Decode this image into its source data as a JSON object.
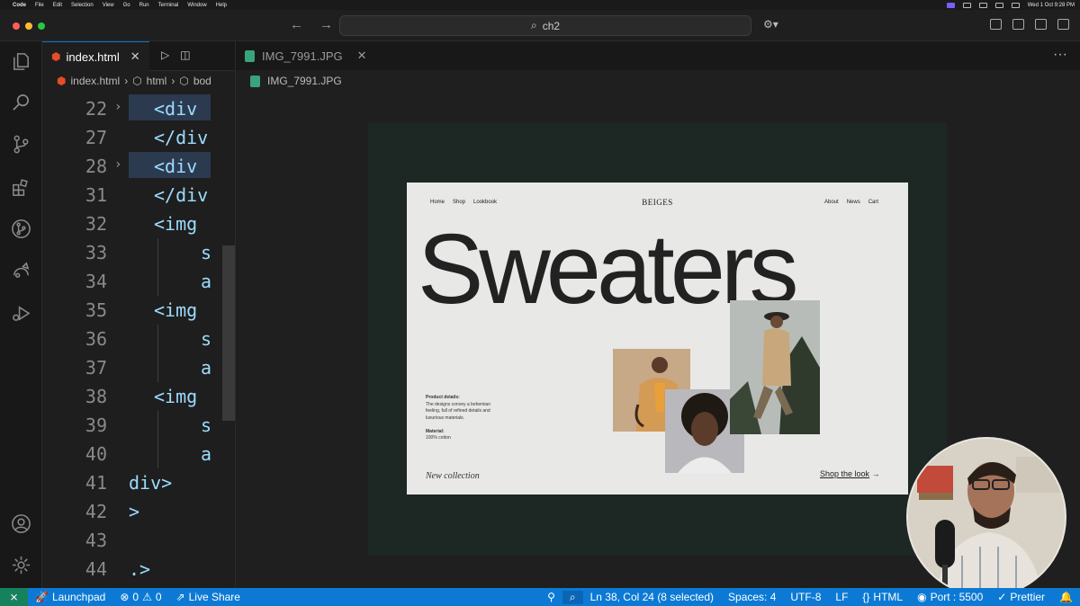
{
  "menubar": {
    "app": "Code",
    "items": [
      "File",
      "Edit",
      "Selection",
      "View",
      "Go",
      "Run",
      "Terminal",
      "Window",
      "Help"
    ],
    "clock": "Wed 1 Oct  9:28 PM"
  },
  "titlebar": {
    "search_text": "ch2"
  },
  "editor": {
    "tab_label": "index.html",
    "tab_close": "✕",
    "breadcrumb": [
      "index.html",
      "html",
      "bod"
    ],
    "lines": [
      {
        "num": "22",
        "fold": "›",
        "text": "<div",
        "indent": 1,
        "selected": true
      },
      {
        "num": "27",
        "fold": "",
        "text": "</div",
        "indent": 1,
        "selected": false
      },
      {
        "num": "28",
        "fold": "›",
        "text": "<div",
        "indent": 1,
        "selected": true
      },
      {
        "num": "31",
        "fold": "",
        "text": "</div",
        "indent": 1,
        "selected": false
      },
      {
        "num": "32",
        "fold": "",
        "text": "<img",
        "indent": 1,
        "selected": false
      },
      {
        "num": "33",
        "fold": "",
        "text": "s",
        "indent": 2,
        "selected": false
      },
      {
        "num": "34",
        "fold": "",
        "text": "a",
        "indent": 2,
        "selected": false
      },
      {
        "num": "35",
        "fold": "",
        "text": "<img",
        "indent": 1,
        "selected": false
      },
      {
        "num": "36",
        "fold": "",
        "text": "s",
        "indent": 2,
        "selected": false
      },
      {
        "num": "37",
        "fold": "",
        "text": "a",
        "indent": 2,
        "selected": false
      },
      {
        "num": "38",
        "fold": "",
        "text": "<img",
        "indent": 1,
        "selected": false
      },
      {
        "num": "39",
        "fold": "",
        "text": "s",
        "indent": 2,
        "selected": false
      },
      {
        "num": "40",
        "fold": "",
        "text": "a",
        "indent": 2,
        "selected": false
      },
      {
        "num": "41",
        "fold": "",
        "text": "div>",
        "indent": 0,
        "selected": false
      },
      {
        "num": "42",
        "fold": "",
        "text": ">",
        "indent": 0,
        "selected": false
      },
      {
        "num": "43",
        "fold": "",
        "text": "",
        "indent": 0,
        "selected": false
      },
      {
        "num": "44",
        "fold": "",
        "text": ".>",
        "indent": 0,
        "selected": false
      }
    ]
  },
  "image_viewer": {
    "tab_label": "IMG_7991.JPG",
    "tab_close": "✕",
    "breadcrumb": "IMG_7991.JPG",
    "more": "···"
  },
  "design": {
    "nav_left": [
      "Home",
      "Shop",
      "Lookbook"
    ],
    "brand": "BEIGES",
    "nav_right": [
      "About",
      "News",
      "Cart"
    ],
    "headline": "Sweaters",
    "details_title": "Product details:",
    "details_text": "The designs convey a bohemian feeling, full of refined details and luxurious materials.",
    "material_title": "Material:",
    "material_text": "100% cotton",
    "new_collection": "New collection",
    "shop_link": "Shop the look",
    "shop_arrow": "→"
  },
  "statusbar": {
    "launchpad": "Launchpad",
    "errors": "0",
    "warnings": "0",
    "liveshare": "Live Share",
    "position": "Ln 38, Col 24 (8 selected)",
    "spaces": "Spaces: 4",
    "encoding": "UTF-8",
    "eol": "LF",
    "language": "HTML",
    "port": "Port : 5500",
    "prettier": "Prettier"
  },
  "colors": {
    "accent": "#0c7ad5",
    "remote": "#16825d",
    "stage": "#1d2723",
    "card": "#e8e8e6"
  }
}
